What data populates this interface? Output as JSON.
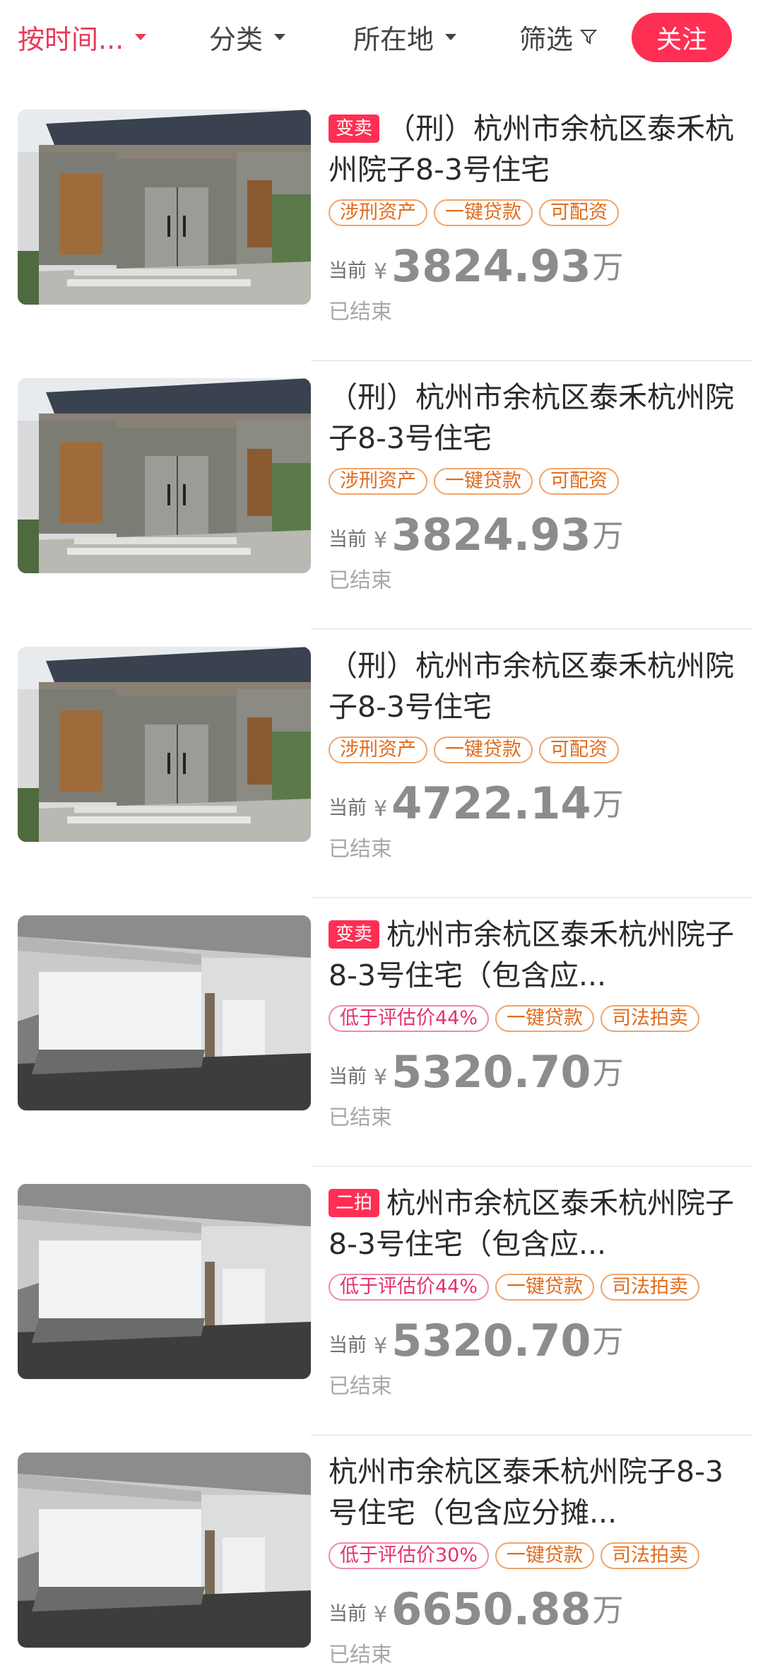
{
  "filters": {
    "sort_label": "按时间...",
    "category_label": "分类",
    "location_label": "所在地",
    "filter_label": "筛选",
    "follow_label": "关注"
  },
  "listings": [
    {
      "badge": "变卖",
      "title": "（刑）杭州市余杭区泰禾杭州院子8-3号住宅",
      "tags": [
        "涉刑资产",
        "一键贷款",
        "可配资"
      ],
      "price_label": "当前",
      "currency": "¥",
      "price": "3824.93",
      "unit": "万",
      "status": "已结束",
      "image": "villa-entrance-photo"
    },
    {
      "badge": "",
      "title": "（刑）杭州市余杭区泰禾杭州院子8-3号住宅",
      "tags": [
        "涉刑资产",
        "一键贷款",
        "可配资"
      ],
      "price_label": "当前",
      "currency": "¥",
      "price": "3824.93",
      "unit": "万",
      "status": "已结束",
      "image": "villa-entrance-photo"
    },
    {
      "badge": "",
      "title": "（刑）杭州市余杭区泰禾杭州院子8-3号住宅",
      "tags": [
        "涉刑资产",
        "一键贷款",
        "可配资"
      ],
      "price_label": "当前",
      "currency": "¥",
      "price": "4722.14",
      "unit": "万",
      "status": "已结束",
      "image": "villa-entrance-photo"
    },
    {
      "badge": "变卖",
      "title": "杭州市余杭区泰禾杭州院子8-3号住宅（包含应...",
      "tags": [
        "低于评估价44%",
        "一键贷款",
        "司法拍卖"
      ],
      "price_label": "当前",
      "currency": "¥",
      "price": "5320.70",
      "unit": "万",
      "status": "已结束",
      "image": "empty-interior-photo"
    },
    {
      "badge": "二拍",
      "title": "杭州市余杭区泰禾杭州院子8-3号住宅（包含应...",
      "tags": [
        "低于评估价44%",
        "一键贷款",
        "司法拍卖"
      ],
      "price_label": "当前",
      "currency": "¥",
      "price": "5320.70",
      "unit": "万",
      "status": "已结束",
      "image": "empty-interior-photo"
    },
    {
      "badge": "",
      "title": "杭州市余杭区泰禾杭州院子8-3号住宅（包含应分摊...",
      "tags": [
        "低于评估价30%",
        "一键贷款",
        "司法拍卖"
      ],
      "price_label": "当前",
      "currency": "¥",
      "price": "6650.88",
      "unit": "万",
      "status": "已结束",
      "image": "empty-interior-photo"
    }
  ]
}
